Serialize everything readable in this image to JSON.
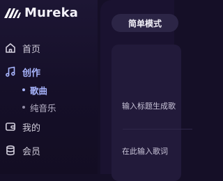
{
  "brand": {
    "name": "Mureka",
    "logo_icon": "mureka-logo-icon",
    "logo_color": "#ffffff"
  },
  "sidebar": {
    "items": [
      {
        "label": "首页",
        "icon": "home-icon",
        "active": false
      },
      {
        "label": "创作",
        "icon": "music-note-icon",
        "active": true
      },
      {
        "label": "我的",
        "icon": "wallet-icon",
        "active": false
      },
      {
        "label": "会员",
        "icon": "database-icon",
        "active": false
      }
    ],
    "sub_items": [
      {
        "label": "歌曲",
        "active": true
      },
      {
        "label": "纯音乐",
        "active": false
      }
    ]
  },
  "main": {
    "mode_tab": "简单模式",
    "title_placeholder": "输入标题生成歌",
    "lyrics_placeholder": "在此输入歌词"
  },
  "colors": {
    "accent": "#a9b6ff",
    "background": "#150f27",
    "panel": "#221a3a"
  }
}
